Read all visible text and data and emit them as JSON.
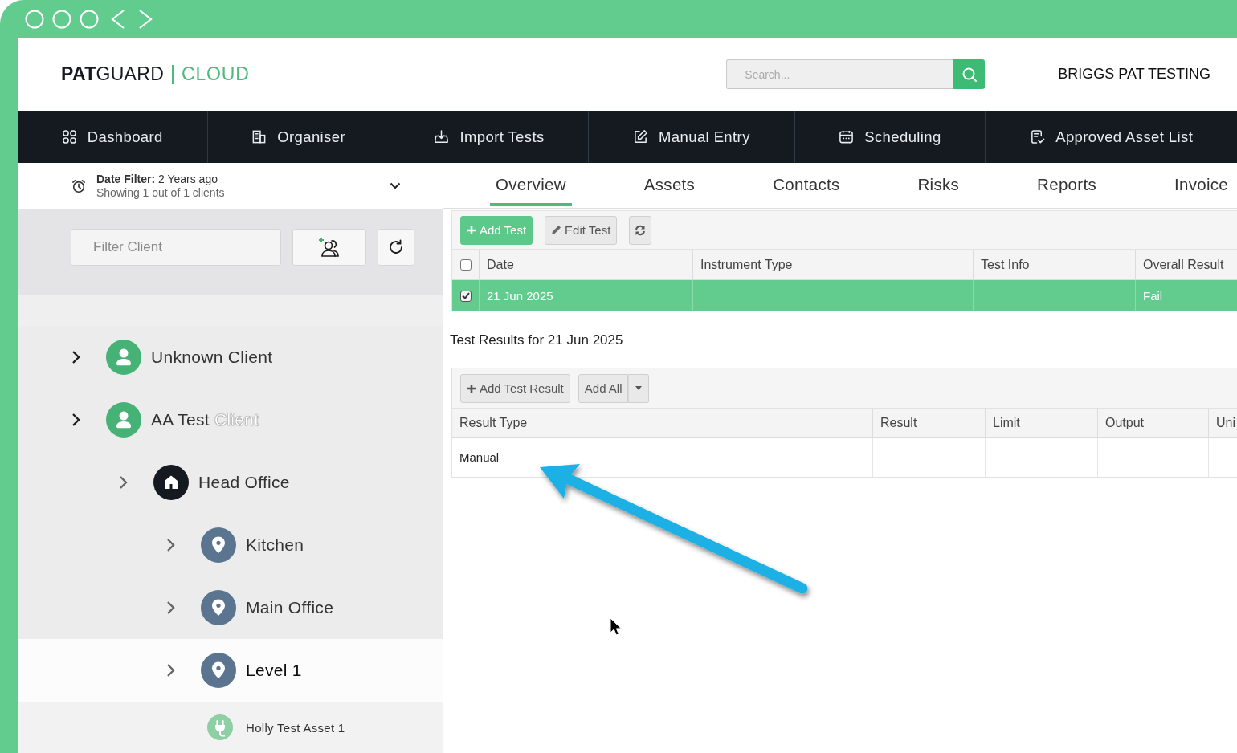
{
  "header": {
    "logo": {
      "brand": "**PAT**GUARD",
      "product": "CLOUD"
    },
    "search": {
      "placeholder": "Search..."
    },
    "account": "BRIGGS PAT TESTING"
  },
  "nav": [
    {
      "label": "Dashboard",
      "selected": false
    },
    {
      "label": "Organiser",
      "selected": false
    },
    {
      "label": "Import Tests",
      "selected": false
    },
    {
      "label": "Manual Entry",
      "selected": false
    },
    {
      "label": "Scheduling",
      "selected": false
    },
    {
      "label": "Approved Asset List",
      "selected": false
    }
  ],
  "date_filter": {
    "label": "**Date Filter:** 2 Years ago",
    "summary": "Showing 1 out of 1 clients"
  },
  "client_filter": {
    "placeholder": "Filter Client"
  },
  "tree": [
    {
      "label": "Unknown Client",
      "kind": "client",
      "selected": false
    },
    {
      "label": "AA Test",
      "ghost_text": "Client",
      "kind": "client",
      "selected": false,
      "children": [
        {
          "label": "Head Office",
          "kind": "site",
          "selected": false,
          "children": [
            {
              "label": "Kitchen",
              "kind": "location",
              "selected": false
            },
            {
              "label": "Main Office",
              "kind": "location",
              "selected": false
            },
            {
              "label": "Level 1",
              "kind": "location",
              "selected": true
            },
            {
              "label": "Holly Test Asset 1",
              "kind": "asset",
              "selected": false
            }
          ]
        }
      ]
    }
  ],
  "tabs": [
    {
      "label": "Overview",
      "selected": true
    },
    {
      "label": "Assets",
      "selected": false
    },
    {
      "label": "Contacts",
      "selected": false
    },
    {
      "label": "Risks",
      "selected": false
    },
    {
      "label": "Reports",
      "selected": false
    },
    {
      "label": "Invoice",
      "selected": false
    }
  ],
  "tests_toolbar": {
    "buttons": [
      {
        "kind": "add",
        "label": "Add Test",
        "primary": true
      },
      {
        "kind": "edit",
        "label": "Edit Test",
        "primary": false
      },
      {
        "kind": "refresh",
        "primary": false
      }
    ]
  },
  "tests_table": {
    "header_checked": false,
    "columns": [
      "Date",
      "Instrument Type",
      "Test Info",
      "Overall Result"
    ],
    "rows": [
      {
        "checked": true,
        "selected": true,
        "cells": [
          "21 Jun 2025",
          null,
          null,
          "Fail"
        ]
      }
    ]
  },
  "results_title": "Test Results for 21 Jun 2025",
  "results_toolbar": {
    "buttons": [
      {
        "kind": "add",
        "label": "Add Test Result",
        "primary": false
      },
      {
        "kind": "split",
        "label": "Add All",
        "primary": false
      }
    ]
  },
  "results_table": {
    "columns": [
      "Result Type",
      "Result",
      "Limit",
      "Output",
      "Uni"
    ],
    "rows": [
      {
        "cells": [
          "Manual",
          null,
          null,
          null,
          null
        ]
      }
    ]
  }
}
